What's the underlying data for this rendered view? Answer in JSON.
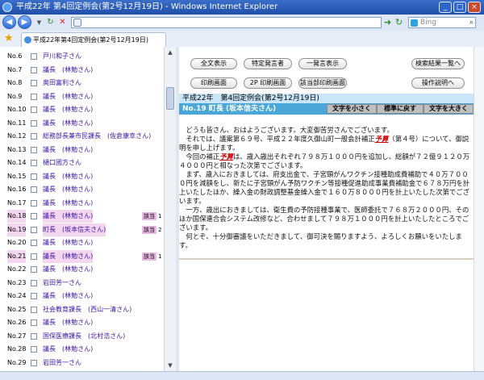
{
  "window": {
    "title": "平成22年 第4回定例会(第2号12月19日) - Windows Internet Explorer"
  },
  "nav": {
    "address_value": "",
    "search_placeholder": "Bing"
  },
  "tab": {
    "label": "平成22年第4回定例会(第2号12月19日)"
  },
  "speakers": [
    {
      "no": "No.6",
      "name": "戸川和子さん",
      "hit": "",
      "count": ""
    },
    {
      "no": "No.7",
      "name": "議長　(林勉さん)",
      "hit": "",
      "count": ""
    },
    {
      "no": "No.8",
      "name": "奥田富利さん",
      "hit": "",
      "count": ""
    },
    {
      "no": "No.9",
      "name": "議長　(林勉さん)",
      "hit": "",
      "count": ""
    },
    {
      "no": "No.10",
      "name": "議長　(林勉さん)",
      "hit": "",
      "count": ""
    },
    {
      "no": "No.11",
      "name": "議長　(林勉さん)",
      "hit": "",
      "count": ""
    },
    {
      "no": "No.12",
      "name": "総務部長兼市民課長　(佐倉康幸さん)",
      "hit": "",
      "count": ""
    },
    {
      "no": "No.13",
      "name": "議長　(林勉さん)",
      "hit": "",
      "count": ""
    },
    {
      "no": "No.14",
      "name": "樋口國方さん",
      "hit": "",
      "count": ""
    },
    {
      "no": "No.15",
      "name": "議長　(林勉さん)",
      "hit": "",
      "count": ""
    },
    {
      "no": "No.16",
      "name": "議長　(林勉さん)",
      "hit": "",
      "count": ""
    },
    {
      "no": "No.17",
      "name": "議長　(林勉さん)",
      "hit": "",
      "count": ""
    },
    {
      "no": "No.18",
      "name": "議長　(林勉さん)",
      "hit": "該当",
      "count": "1"
    },
    {
      "no": "No.19",
      "name": "町長　(坂本信夫さん)",
      "hit": "該当",
      "count": "2"
    },
    {
      "no": "No.20",
      "name": "議長　(林勉さん)",
      "hit": "",
      "count": ""
    },
    {
      "no": "No.21",
      "name": "議長　(林勉さん)",
      "hit": "該当",
      "count": "1"
    },
    {
      "no": "No.22",
      "name": "議長　(林勉さん)",
      "hit": "",
      "count": ""
    },
    {
      "no": "No.23",
      "name": "岩田芳一さん",
      "hit": "",
      "count": ""
    },
    {
      "no": "No.24",
      "name": "議長　(林勉さん)",
      "hit": "",
      "count": ""
    },
    {
      "no": "No.25",
      "name": "社会教育課長　(西山一清さん)",
      "hit": "",
      "count": ""
    },
    {
      "no": "No.26",
      "name": "議長　(林勉さん)",
      "hit": "",
      "count": ""
    },
    {
      "no": "No.27",
      "name": "国保医療課長　(北村浩さん)",
      "hit": "",
      "count": ""
    },
    {
      "no": "No.28",
      "name": "議長　(林勉さん)",
      "hit": "",
      "count": ""
    },
    {
      "no": "No.29",
      "name": "岩田芳一さん",
      "hit": "",
      "count": ""
    }
  ],
  "buttons": {
    "show_all": "全文表示",
    "show_speaker": "特定発言者",
    "show_hits": "一発言表示",
    "back_to_results": "検索結果一覧へ",
    "print_screen": "印刷画面",
    "print_2p": "2P 印刷画面",
    "print_hit": "該当部印刷画面",
    "usage": "操作説明へ"
  },
  "meeting": {
    "title": "平成22年　第4回定例会(第2号12月19日)"
  },
  "speaker_bar": {
    "label": "No.19 町長 (坂本信夫さん)",
    "font_small": "文字を小さく",
    "font_reset": "標準に戻す",
    "font_large": "文字を大きく"
  },
  "speech": {
    "p1": "　どうも皆さん、おはようございます。大変御苦労さんでございます。",
    "p2a": "　それでは、議案第６９号、平成２２年度久御山町一般会計補正",
    "p2_hit": "予算",
    "p2b": "（第４号）について、御説明を申し上げます。",
    "p3a": "　今回の補正",
    "p3_hit": "予算",
    "p3b": "は、歳入歳出それぞれ７９８万１０００円を追加し、総額が７２億９１２０万４０００円と相なった次第でございます。",
    "p4": "　まず、歳入におきましては、府支出金で、子宮頸がんワクチン接種助成費補助で４０万７０００円を減額をし、新たに子宮頸がん予防ワクチン等接種促進助成事業費補助金で６７８万円を計上いたしたほか、繰入金の財政調整基金繰入金で１６０万８０００円を計上いたした次第でございます。",
    "p5": "　一方、歳出におきましては、衛生費の予防接種事業で、医師委託で７６８万２０００円、そのほか国保連合会システム改修など、合わせまして７９８万１０００円を計上いたしたところでございます。",
    "p6": "　何とぞ、十分御審議をいただきまして、御可決を賜りますよう、よろしくお願いをいたします。"
  }
}
